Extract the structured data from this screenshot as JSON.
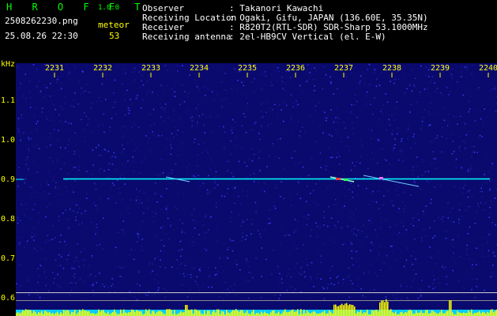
{
  "app": {
    "logo": "H R O F F T",
    "version": "1.0.0"
  },
  "file": {
    "name": "2508262230.png",
    "datetime": "25.08.26 22:30"
  },
  "counter": {
    "label": "meteor",
    "value": "53"
  },
  "info": {
    "observer_label": "Observer",
    "observer_value": ": Takanori Kawachi",
    "location_label": "Receiving Location",
    "location_value": ": Ogaki, Gifu, JAPAN (136.60E, 35.35N)",
    "receiver_label": "Receiver",
    "receiver_value": ": R820T2(RTL-SDR) SDR-Sharp 53.1000MHz",
    "antenna_label": "Receiving antenna",
    "antenna_value": ": 2el-HB9CV Vertical (el. E-W)"
  },
  "axis": {
    "unit": "kHz",
    "time_ticks": [
      "2231",
      "2232",
      "2233",
      "2234",
      "2235",
      "2236",
      "2237",
      "2238",
      "2239",
      "2240"
    ],
    "freq_ticks": [
      "1.1",
      "1.0",
      "0.9",
      "0.8",
      "0.7",
      "0.6"
    ]
  },
  "colors": {
    "background": "#000000",
    "spectrum": "#0a0a6e",
    "axis_text": "#ffff00",
    "signal": "#00ffff",
    "meteor_head": "#ff3b3b",
    "level_fill": "#ffff00",
    "level_base": "#00ccff"
  }
}
